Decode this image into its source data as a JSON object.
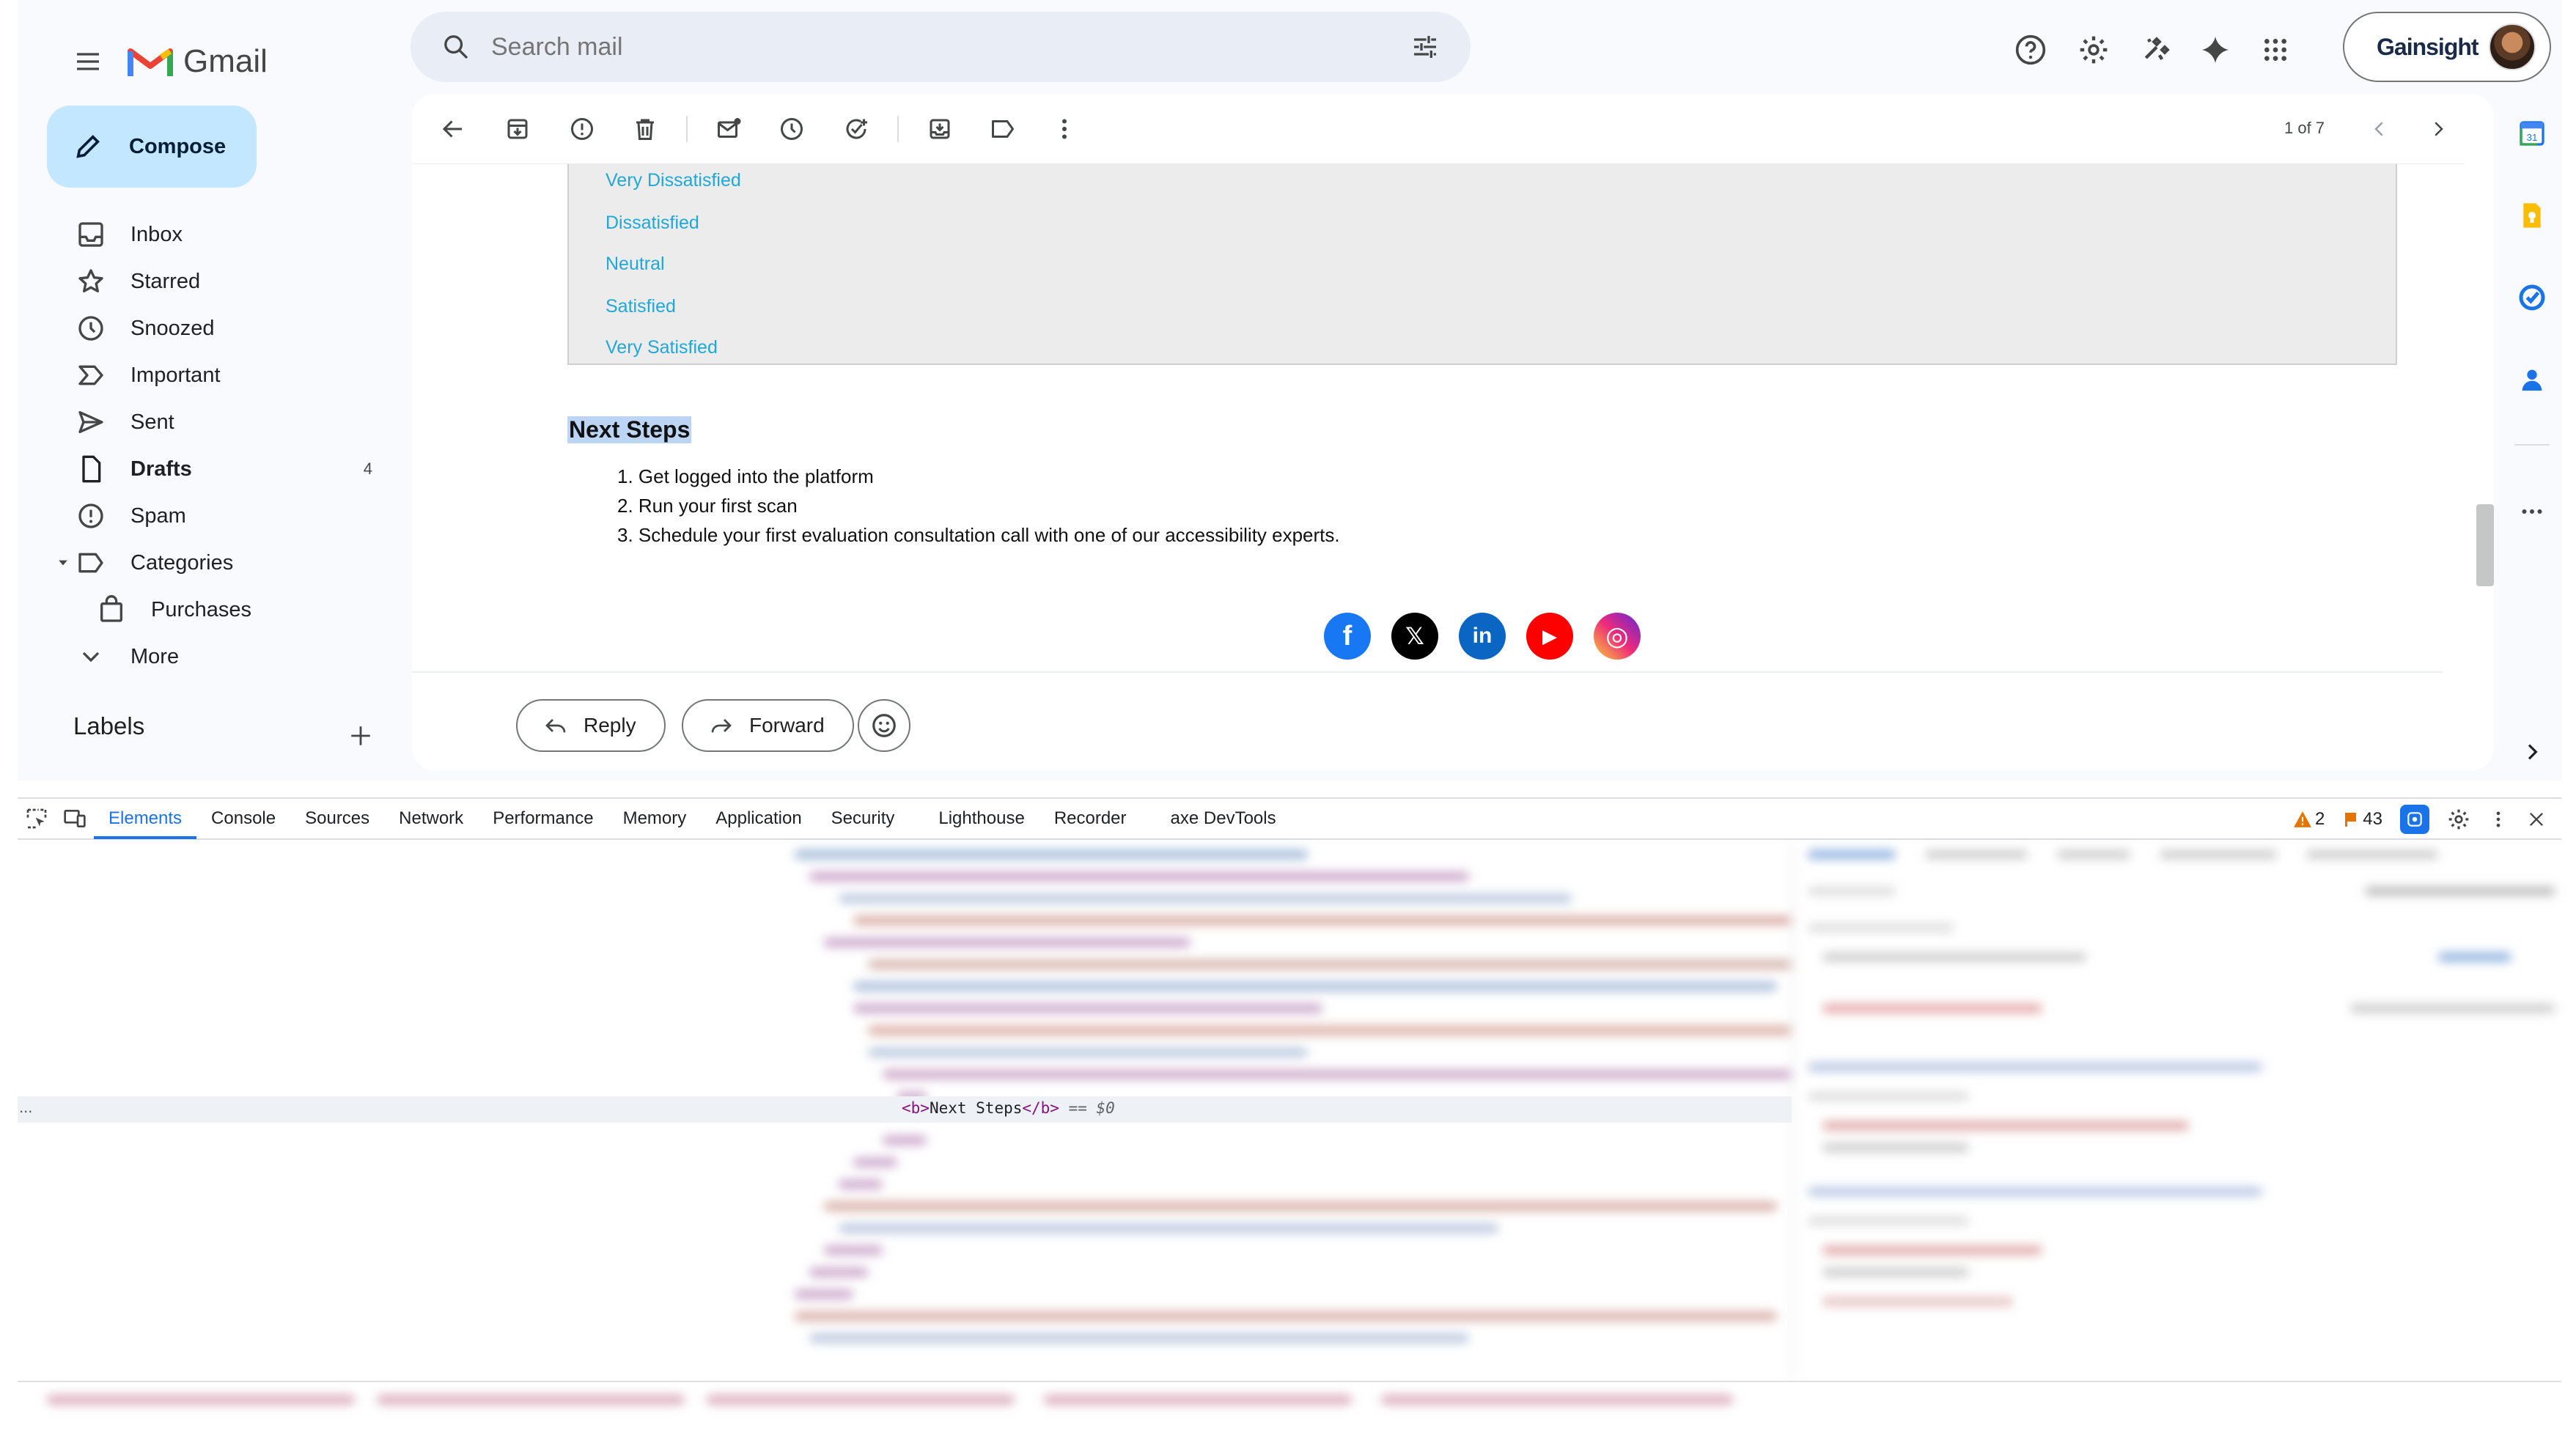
{
  "header": {
    "app_name": "Gmail",
    "search_placeholder": "Search mail",
    "account_brand": "Gainsight"
  },
  "compose_label": "Compose",
  "nav": {
    "items": [
      {
        "label": "Inbox",
        "icon": "inbox-icon"
      },
      {
        "label": "Starred",
        "icon": "star-icon"
      },
      {
        "label": "Snoozed",
        "icon": "clock-icon"
      },
      {
        "label": "Important",
        "icon": "important-icon"
      },
      {
        "label": "Sent",
        "icon": "send-icon"
      },
      {
        "label": "Drafts",
        "icon": "draft-icon",
        "count": "4",
        "bold": true
      },
      {
        "label": "Spam",
        "icon": "spam-icon"
      },
      {
        "label": "Categories",
        "icon": "label-icon"
      },
      {
        "label": "Purchases",
        "icon": "shopping-bag-icon"
      },
      {
        "label": "More",
        "icon": "chevron-down-icon"
      }
    ],
    "labels_heading": "Labels"
  },
  "toolbar": {
    "pager": "1 of 7"
  },
  "email": {
    "survey_options": [
      "Very Dissatisfied",
      "Dissatisfied",
      "Neutral",
      "Satisfied",
      "Very Satisfied"
    ],
    "next_steps_title": "Next Steps",
    "steps": [
      "1. Get logged into the platform",
      "2. Run your first scan",
      "3. Schedule your first evaluation consultation call with one of our accessibility experts."
    ],
    "social": [
      {
        "name": "facebook-icon",
        "glyph": "f",
        "color": "#1877f2"
      },
      {
        "name": "x-icon",
        "glyph": "𝕏",
        "color": "#000000"
      },
      {
        "name": "linkedin-icon",
        "glyph": "in",
        "color": "#0a66c2"
      },
      {
        "name": "youtube-icon",
        "glyph": "▶",
        "color": "#ff0000"
      },
      {
        "name": "instagram-icon",
        "glyph": "◎",
        "color": "#e1306c"
      }
    ],
    "reply_label": "Reply",
    "forward_label": "Forward"
  },
  "devtools": {
    "tabs": [
      "Elements",
      "Console",
      "Sources",
      "Network",
      "Performance",
      "Memory",
      "Application",
      "Security",
      "Lighthouse",
      "Recorder",
      "axe DevTools"
    ],
    "active_tab": "Elements",
    "warnings": "2",
    "issues": "43",
    "selected_node_open": "<b>",
    "selected_node_text": "Next Steps",
    "selected_node_close": "</b>",
    "selected_node_ref": "== $0",
    "ellipsis": "..."
  },
  "colors": {
    "compose_bg": "#c2e7ff",
    "link": "#1fa8d9",
    "selection": "#bcd5f5",
    "devtools_accent": "#1a73e8"
  }
}
